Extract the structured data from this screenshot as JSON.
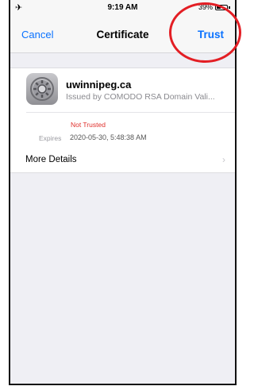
{
  "status_bar": {
    "left_icon": "airplane-icon",
    "time": "9:19 AM",
    "battery": "39%",
    "battery_level": 0.39
  },
  "nav": {
    "cancel_label": "Cancel",
    "title": "Certificate",
    "trust_label": "Trust"
  },
  "certificate": {
    "icon": "gear-icon",
    "name": "uwinnipeg.ca",
    "issuer": "Issued by COMODO RSA Domain Vali...",
    "trust_status": "Not Trusted",
    "expires_label": "Expires",
    "expires_value": "2020-05-30, 5:48:38 AM"
  },
  "details": {
    "label": "More Details",
    "chevron": "chevron-right-icon"
  },
  "colors": {
    "accent": "#0a72ff",
    "warning": "#e0302c",
    "annotation": "#e31e24"
  }
}
